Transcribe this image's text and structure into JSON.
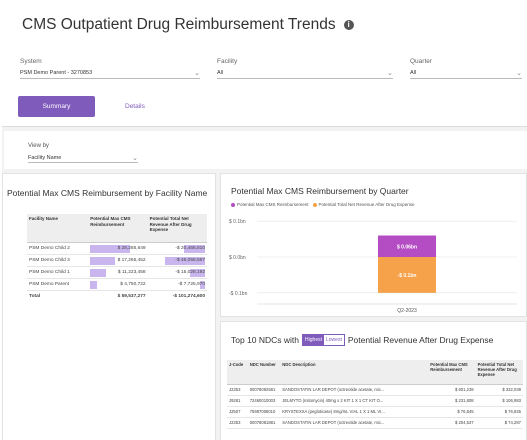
{
  "page_title": "CMS Outpatient Drug Reimbursement Trends",
  "info_icon_glyph": "i",
  "filters": [
    {
      "label": "System",
      "value": "PSM Demo Parent - 3270853"
    },
    {
      "label": "Facility",
      "value": "All"
    },
    {
      "label": "Quarter",
      "value": "All"
    }
  ],
  "tabs": {
    "summary": "Summary",
    "details": "Details"
  },
  "viewby": {
    "label": "View by",
    "value": "Facility Name"
  },
  "facility_panel": {
    "title": "Potential Max CMS Reimbursement by Facility Name",
    "columns": [
      "Facility Name",
      "Potential Max CMS Reimbursement",
      "Potential Total Net Revenue After Drug Expense"
    ],
    "rows": [
      {
        "name": "PSM Demo Child 2",
        "max": "$ 28,285,649",
        "net": "-$ 20,466,810",
        "max_frac": 1.0,
        "net_frac": 0.52
      },
      {
        "name": "PSM Demo Child 3",
        "max": "$ 17,265,452",
        "net": "-$ 46,058,567",
        "max_frac": 0.61,
        "net_frac": 1.0
      },
      {
        "name": "PSM Demo Child 1",
        "max": "$ 11,223,458",
        "net": "-$ 15,028,192",
        "max_frac": 0.4,
        "net_frac": 0.37
      },
      {
        "name": "PSM Demo Parent",
        "max": "$ 4,750,722",
        "net": "-$ 7,725,970",
        "max_frac": 0.17,
        "net_frac": 0.12
      }
    ],
    "total": {
      "name": "Total",
      "max": "$ 59,537,277",
      "net": "-$ 101,274,600"
    }
  },
  "quarter_panel": {
    "title": "Potential Max CMS Reimbursement by Quarter"
  },
  "chart_data": {
    "type": "bar",
    "stacked": true,
    "categories": [
      "Q2-2023"
    ],
    "series": [
      {
        "name": "Potential Max CMS Reimbursement",
        "values": [
          0.06
        ],
        "label": "$ 0.06bn",
        "color": "#b44dc4"
      },
      {
        "name": "Potential Total Net Revenue After Drug Expense",
        "values": [
          -0.1
        ],
        "label": "-$ 0.1bn",
        "color": "#f5a24a"
      }
    ],
    "yticks": [
      "$ 0.1bn",
      "$ 0.0bn",
      "-$ 0.1bn"
    ],
    "ylim": [
      -0.12,
      0.12
    ],
    "legend": "top-left"
  },
  "ndc_panel": {
    "title_prefix": "Top 10 NDCs with",
    "toggle_on": "Highest",
    "toggle_off": "Lowest",
    "title_suffix": "Potential Revenue After Drug Expense",
    "columns": [
      "J-Code",
      "NDC Number",
      "NDC Description",
      "Potential Max CMS Reimbursement",
      "Potential Total Net Revenue After Drug Expense"
    ],
    "rows": [
      {
        "jcode": "J2353",
        "ndc": "00078082581",
        "desc": "SANDOSTATIN LAR DEPOT (octreotide acetate, mic...",
        "max": "$ 601,239",
        "net": "$ 332,039"
      },
      {
        "jcode": "J9281",
        "ndc": "72460010003",
        "desc": "JELMYTO (mitomycin) 40mg x 2 KIT 1 X 1 CT KIT O...",
        "max": "$ 231,808",
        "net": "$ 106,983"
      },
      {
        "jcode": "J2507",
        "ndc": "75987008010",
        "desc": "KRYSTEXXA (pegloticase) 8mg/mL VIAL 1 X 1 ML VI...",
        "max": "$ 76,845",
        "net": "$ 76,845"
      },
      {
        "jcode": "J2353",
        "ndc": "00078081881",
        "desc": "SANDOSTATIN LAR DEPOT (octreotide acetate, mic...",
        "max": "$ 204,537",
        "net": "$ 74,287"
      }
    ]
  }
}
